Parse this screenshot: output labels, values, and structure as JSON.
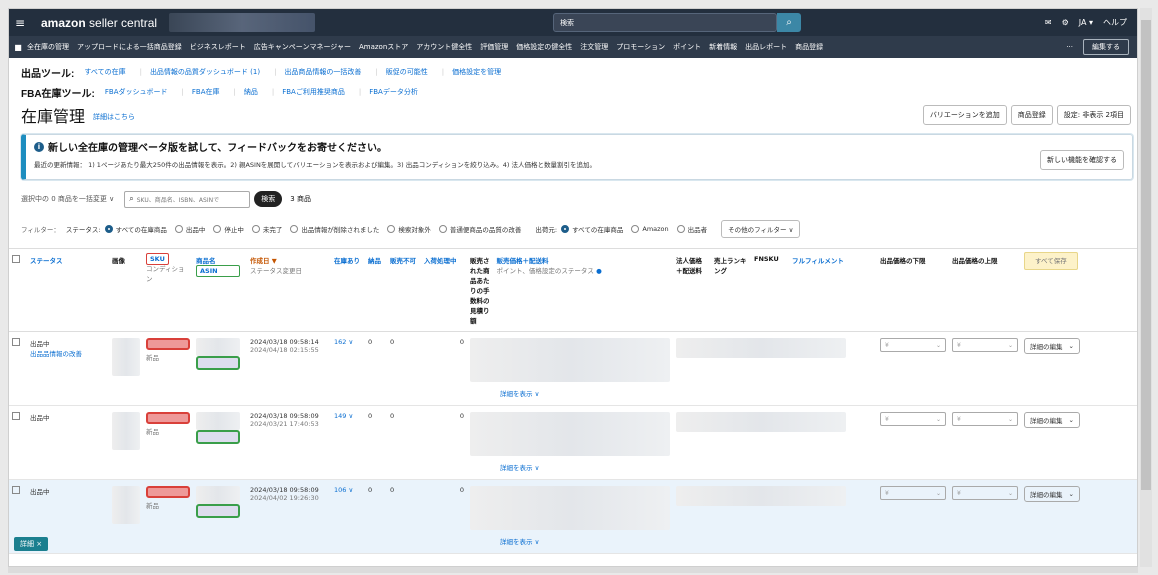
{
  "topbar": {
    "logo_main": "amazon",
    "logo_sub": " seller central",
    "search_placeholder": "検索",
    "lang": "JA ▾",
    "help": "ヘルプ"
  },
  "nav": {
    "items": [
      "全在庫の管理",
      "アップロードによる一括商品登録",
      "ビジネスレポート",
      "広告キャンペーンマネージャー",
      "Amazonストア",
      "アカウント健全性",
      "評価管理",
      "価格設定の健全性",
      "注文管理",
      "プロモーション",
      "ポイント",
      "新着情報",
      "出品レポート",
      "商品登録"
    ],
    "more": "···",
    "edit": "編集する"
  },
  "tools1": {
    "label": "出品ツール:",
    "links": [
      "すべての在庫",
      "出品情報の品質ダッシュボード (1)",
      "出品商品情報の一括改善",
      "販促の可能性",
      "価格設定を管理"
    ]
  },
  "tools2": {
    "label": "FBA在庫ツール:",
    "links": [
      "FBAダッシュボード",
      "FBA在庫",
      "納品",
      "FBAご利用推奨商品",
      "FBAデータ分析"
    ]
  },
  "page": {
    "title": "在庫管理",
    "learn": "詳細はこちら",
    "buttons": [
      "バリエーションを追加",
      "商品登録",
      "設定: 非表示 2項目"
    ]
  },
  "banner": {
    "title": "新しい全在庫の管理ベータ版を試して、フィードバックをお寄せください。",
    "text": "最近の更新情報： 1) 1ページあたり最大250件の出品情報を表示。2) 親ASINを展開してバリエーションを表示および編集。3) 出品コンディションを絞り込み。4) 法人価格と数量割引を追加。",
    "button": "新しい機能を確認する"
  },
  "searchbar": {
    "bulk": "選択中の 0 商品を一括変更 ∨",
    "placeholder": "SKU、商品名、ISBN、ASINで",
    "button": "検索",
    "count": "3 商品"
  },
  "filters": {
    "label": "フィルター：",
    "status_label": "ステータス:",
    "status_opts": [
      "すべての在庫商品",
      "出品中",
      "停止中",
      "未完了",
      "出品情報が削除されました",
      "検索対象外",
      "普通便商品の品質の改善"
    ],
    "ship_label": "出荷元:",
    "ship_opts": [
      "すべての在庫商品",
      "Amazon",
      "出品者"
    ],
    "other": "その他のフィルター ∨"
  },
  "table": {
    "headers": {
      "status": "ステータス",
      "image": "画像",
      "sku": "SKU",
      "condition": "コンディション",
      "title": "商品名",
      "asin": "ASIN",
      "created": "作成日 ▼",
      "status_changed": "ステータス変更日",
      "available": "在庫あり",
      "inbound": "納品",
      "unfulfillable": "販売不可",
      "receiving": "入荷処理中",
      "fee_preview": "販売された商品あたりの手数料の見積り額",
      "price": "販売価格＋配送料",
      "price_sub": "ポイント、価格設定のステータス",
      "business": "法人価格＋配送料",
      "rank": "売上ランキング",
      "fnsku": "FNSKU",
      "fulfillment": "フルフィルメント",
      "min_price": "出品価格の下限",
      "max_price": "出品価格の上限",
      "save_all": "すべて保存"
    },
    "rows": [
      {
        "status": "出品中",
        "status_sub": "出品品情報の改善",
        "condition": "新品",
        "created": "2024/03/18 09:58:14",
        "changed": "2024/04/18 02:15:55",
        "available": "162 ∨",
        "inbound": "0",
        "unfulfillable": "0",
        "receiving": "0",
        "detail": "詳細を表示 ∨",
        "edit": "詳細の編集"
      },
      {
        "status": "出品中",
        "status_sub": "",
        "condition": "新品",
        "created": "2024/03/18 09:58:09",
        "changed": "2024/03/21 17:40:53",
        "available": "149 ∨",
        "inbound": "0",
        "unfulfillable": "0",
        "receiving": "0",
        "detail": "詳細を表示 ∨",
        "edit": "詳細の編集"
      },
      {
        "status": "出品中",
        "status_sub": "",
        "condition": "新品",
        "created": "2024/03/18 09:58:09",
        "changed": "2024/04/02 19:26:30",
        "available": "106 ∨",
        "inbound": "0",
        "unfulfillable": "0",
        "receiving": "0",
        "detail": "詳細を表示 ∨",
        "edit": "詳細の編集"
      }
    ],
    "input_placeholder": "¥"
  },
  "bottom_tag": "詳細 ×"
}
